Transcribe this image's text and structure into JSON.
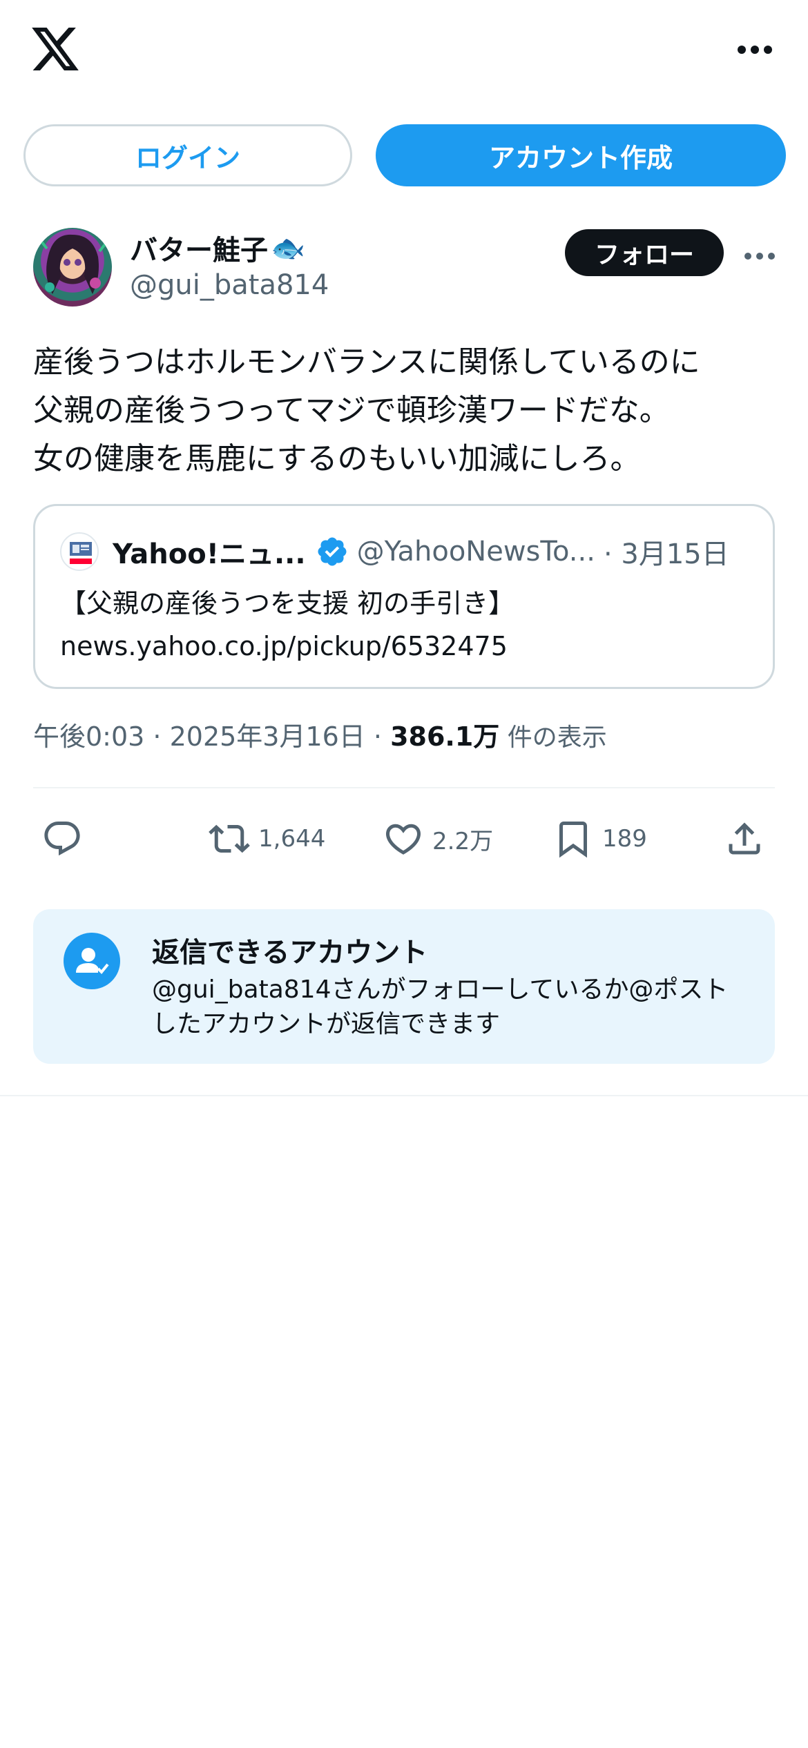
{
  "header": {
    "logo_label": "X",
    "more_icon": "more-horizontal-icon"
  },
  "auth": {
    "login_label": "ログイン",
    "signup_label": "アカウント作成"
  },
  "author": {
    "display_name": "バター鮭子",
    "name_emoji": "🐟",
    "handle": "@gui_bata814",
    "follow_label": "フォロー"
  },
  "tweet": {
    "lines": [
      "産後うつはホルモンバランスに関係しているのに",
      "父親の産後うつってマジで頓珍漢ワードだな。",
      "女の健康を馬鹿にするのもいい加減にしろ。"
    ]
  },
  "quote": {
    "name": "Yahoo!ニュ...",
    "handle": "@YahooNewsTo...",
    "date": "· 3月15日",
    "text": "【父親の産後うつを支援 初の手引き】",
    "link": "news.yahoo.co.jp/pickup/6532475"
  },
  "meta": {
    "time": "午後0:03",
    "sep1": " · ",
    "date": "2025年3月16日",
    "sep2": " · ",
    "views": "386.1万",
    "views_label": " 件の表示"
  },
  "actions": {
    "reply_icon": "reply-icon",
    "retweets": "1,644",
    "likes": "2.2万",
    "bookmarks": "189",
    "share_icon": "share-icon"
  },
  "reply_settings": {
    "title": "返信できるアカウント",
    "description": "@gui_bata814さんがフォローしているか@ポストしたアカウントが返信できます"
  },
  "colors": {
    "accent": "#1d9bf0",
    "text": "#0f1419",
    "muted": "#536471",
    "border": "#cfd9de",
    "reply_box_bg": "#e8f5fd"
  }
}
